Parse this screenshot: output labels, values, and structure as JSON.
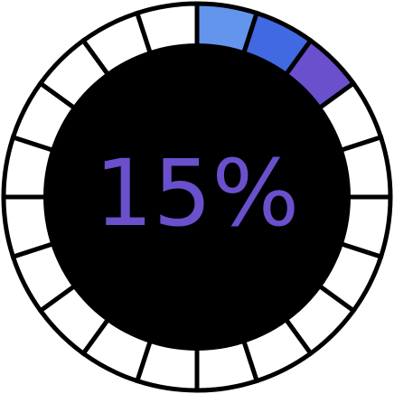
{
  "progress": {
    "percent_label": "15%",
    "value": 0.15
  },
  "ring": {
    "segment_count": 20,
    "filled_segments": 3,
    "segment_colors_filled": [
      "#6495ed",
      "#4169e1",
      "#6a50cc"
    ],
    "segment_color_empty": "#ffffff",
    "separator_color": "#000000",
    "center_color": "#000000"
  },
  "colors": {
    "text": "#6a50cc"
  }
}
